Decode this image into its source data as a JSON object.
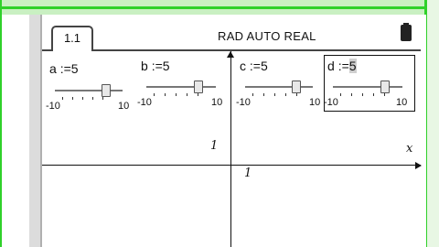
{
  "tab": {
    "label": "1.1"
  },
  "status": {
    "settings": "RAD AUTO REAL"
  },
  "graph": {
    "x_axis_label": "x",
    "y_mark": "1",
    "x_mark": "1"
  },
  "sliders": [
    {
      "var": "a",
      "assign": ":=",
      "value": "5",
      "min": "-10",
      "max": "10",
      "level": 5,
      "focused": false
    },
    {
      "var": "b",
      "assign": ":=",
      "value": "5",
      "min": "-10",
      "max": "10",
      "level": 5,
      "focused": false
    },
    {
      "var": "c",
      "assign": ":=",
      "value": "5",
      "min": "-10",
      "max": "10",
      "level": 5,
      "focused": false
    },
    {
      "var": "d",
      "assign": ":=",
      "value": "5",
      "min": "-10",
      "max": "10",
      "level": 5,
      "focused": true
    }
  ],
  "colors": {
    "frame": "#2fd12a",
    "accent": "#cfcfcf"
  }
}
